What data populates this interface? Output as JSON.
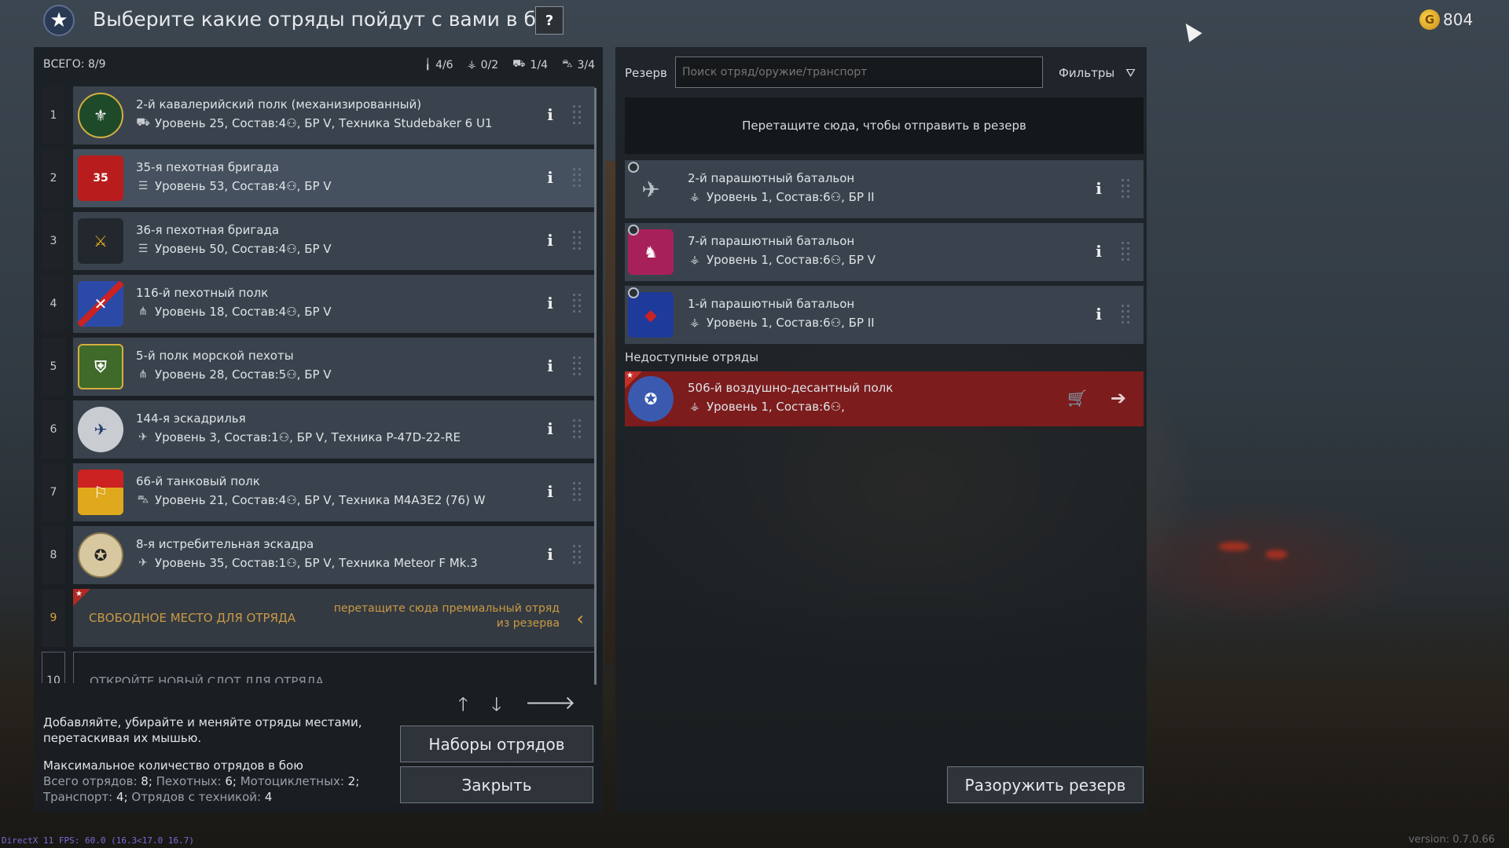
{
  "header": {
    "title": "Выберите какие отряды пойдут с вами в бой",
    "help_label": "?",
    "gold_amount": "804",
    "gold_icon": "G"
  },
  "left": {
    "total": "ВСЕГО: 8/9",
    "counters": [
      {
        "icon": "infantry-icon",
        "glyph": "╽",
        "value": "4/6"
      },
      {
        "icon": "paratrooper-icon",
        "glyph": "⚶",
        "value": "0/2"
      },
      {
        "icon": "vehicle-icon",
        "glyph": "⛟",
        "value": "1/4"
      },
      {
        "icon": "tank-icon",
        "glyph": "⛍",
        "value": "3/4"
      }
    ],
    "squads": [
      {
        "num": "1",
        "name": "2-й кавалерийский полк (механизированный)",
        "type_glyph": "⛟",
        "stats": "Уровень 25, Состав:4⚇,  БР V,  Техника Studebaker 6 U1",
        "emblem_color": "#1e4a2a",
        "emblem_glyph": "⚜"
      },
      {
        "num": "2",
        "name": "35-я пехотная бригада",
        "type_glyph": "☰",
        "stats": "Уровень 53, Состав:4⚇,  БР V",
        "emblem_color": "#b81c1c",
        "emblem_glyph": "35"
      },
      {
        "num": "3",
        "name": "36-я пехотная бригада",
        "type_glyph": "☰",
        "stats": "Уровень 50, Состав:4⚇,  БР V",
        "emblem_color": "#22282e",
        "emblem_glyph": "⚔"
      },
      {
        "num": "4",
        "name": "116-й пехотный полк",
        "type_glyph": "⋔",
        "stats": "Уровень 18, Состав:4⚇,  БР V",
        "emblem_color": "#2b4aa8",
        "emblem_glyph": "✕"
      },
      {
        "num": "5",
        "name": "5-й полк морской пехоты",
        "type_glyph": "⋔",
        "stats": "Уровень 28, Состав:5⚇,  БР V",
        "emblem_color": "#3f6a2a",
        "emblem_glyph": "⛨"
      },
      {
        "num": "6",
        "name": "144-я эскадрилья",
        "type_glyph": "✈",
        "stats": "Уровень 3, Состав:1⚇,  БР V,  Техника P-47D-22-RE",
        "emblem_color": "#c9cdd2",
        "emblem_glyph": "✈"
      },
      {
        "num": "7",
        "name": "66-й танковый полк",
        "type_glyph": "⛍",
        "stats": "Уровень 21, Состав:4⚇,  БР V,  Техника M4A3E2 (76) W",
        "emblem_color": "#e0a81c",
        "emblem_glyph": "⚐"
      },
      {
        "num": "8",
        "name": "8-я истребительная эскадра",
        "type_glyph": "✈",
        "stats": "Уровень 35, Состав:1⚇,  БР V,  Техника Meteor F Mk.3",
        "emblem_color": "#d8c8a0",
        "emblem_glyph": "✪"
      }
    ],
    "free_slot": {
      "num": "9",
      "label": "СВОБОДНОЕ МЕСТО ДЛЯ ОТРЯДА",
      "hint": "перетащите сюда премиальный отряд из резерва"
    },
    "locked_slot": {
      "num": "10",
      "label": "ОТКРОЙТЕ НОВЫЙ СЛОТ ДЛЯ ОТРЯДА"
    },
    "help_text": "Добавляйте, убирайте и меняйте отряды местами, перетаскивая их мышью.",
    "max_title": "Максимальное количество отрядов в бою",
    "max_line1_labels": [
      "Всего отрядов:",
      "Пехотных:",
      "Мотоциклетных:"
    ],
    "max_line1_values": [
      "8",
      "6",
      "2"
    ],
    "max_line2_labels": [
      "Транспорт:",
      "Отрядов с техникой:"
    ],
    "max_line2_values": [
      "4",
      "4"
    ],
    "btn_presets": "Наборы отрядов",
    "btn_close": "Закрыть"
  },
  "right": {
    "reserve_label": "Резерв",
    "search_placeholder": "Поиск отряд/оружие/транспорт",
    "filters_label": "Фильтры",
    "dropzone_text": "Перетащите сюда, чтобы отправить в резерв",
    "reserve_squads": [
      {
        "name": "2-й парашютный батальон",
        "stats": "Уровень 1, Состав:6⚇,  БР II",
        "emblem_color": "#8a9098",
        "emblem_glyph": "✈"
      },
      {
        "name": "7-й парашютный батальон",
        "stats": "Уровень 1, Состав:6⚇,  БР V",
        "emblem_color": "#a8205a",
        "emblem_glyph": "♞"
      },
      {
        "name": "1-й парашютный батальон",
        "stats": "Уровень 1, Состав:6⚇,  БР II",
        "emblem_color": "#1e3a9a",
        "emblem_glyph": "◆"
      }
    ],
    "unavailable_label": "Недоступные отряды",
    "unavailable_squad": {
      "name": "506-й воздушно-десантный полк",
      "stats": "Уровень 1, Состав:6⚇,",
      "emblem_color": "#3a5ab0",
      "emblem_glyph": "✪"
    },
    "btn_disarm": "Разоружить резерв"
  },
  "footer": {
    "fps": "DirectX 11 FPS: 60.0 (16.3<17.0 16.7)",
    "version": "version: 0.7.0.66"
  }
}
